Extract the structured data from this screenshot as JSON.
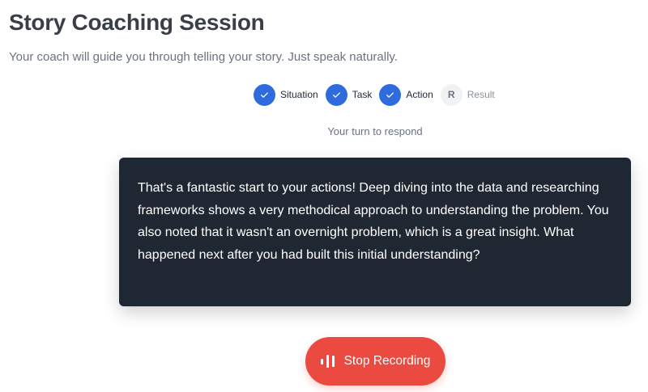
{
  "header": {
    "title": "Story Coaching Session",
    "subtitle": "Your coach will guide you through telling your story. Just speak naturally."
  },
  "stepper": {
    "steps": [
      {
        "label": "Situation",
        "status": "complete"
      },
      {
        "label": "Task",
        "status": "complete"
      },
      {
        "label": "Action",
        "status": "complete"
      },
      {
        "label": "Result",
        "status": "pending",
        "initial": "R"
      }
    ]
  },
  "status": {
    "turn": "Your turn to respond"
  },
  "message": {
    "text": "That's a fantastic start to your actions! Deep diving into the data and researching frameworks shows a very methodical approach to understanding the problem. You also noted that it wasn't an overnight problem, which is a great insight. What happened next after you had built this initial understanding?"
  },
  "controls": {
    "record_label": "Stop Recording",
    "record_icon": "waveform-icon"
  },
  "colors": {
    "accent": "#2f6bde",
    "card_bg": "#1f2733",
    "record_bg": "#ea4a3f"
  }
}
